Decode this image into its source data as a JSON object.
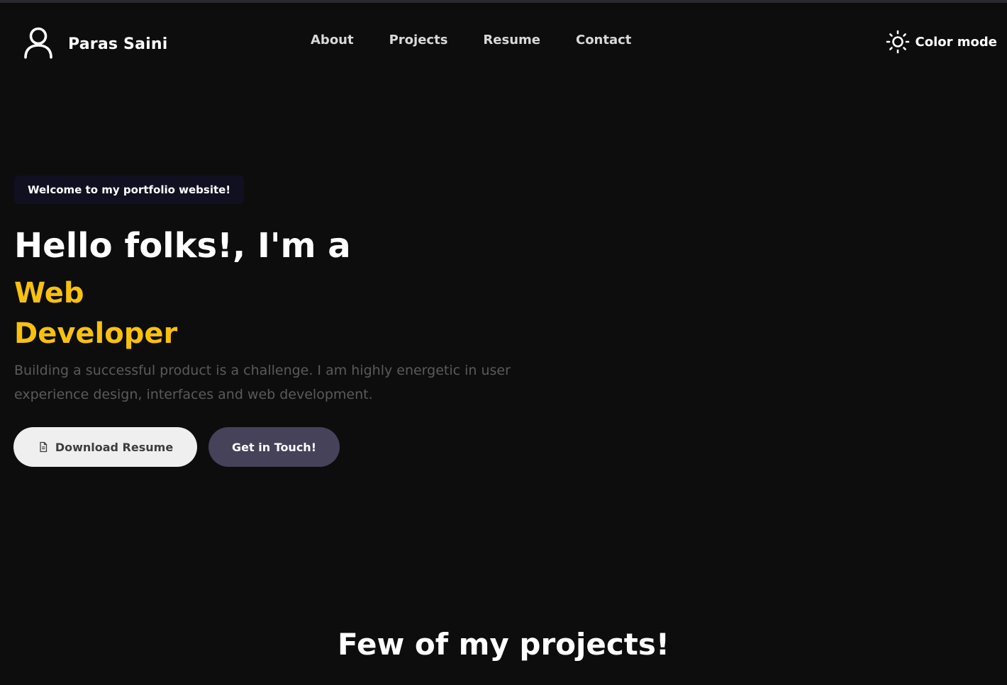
{
  "brand": {
    "icon": "user-icon",
    "name": "Paras Saini"
  },
  "nav": {
    "items": [
      {
        "label": "About"
      },
      {
        "label": "Projects"
      },
      {
        "label": "Resume"
      },
      {
        "label": "Contact"
      }
    ]
  },
  "color_mode": {
    "icon": "sun-icon",
    "label": "Color mode"
  },
  "hero": {
    "badge": "Welcome to my portfolio website!",
    "title": "Hello folks!, I'm a",
    "role_line1": "Web",
    "role_line2": "Developer",
    "description": "Building a successful product is a challenge. I am highly energetic in user experience design, interfaces and web development.",
    "download_button": {
      "label": "Download Resume",
      "icon": "document-icon"
    },
    "contact_button": {
      "label": "Get in Touch!"
    }
  },
  "projects_section": {
    "title": "Few of my projects!"
  },
  "colors": {
    "background": "#0d0d0d",
    "accent": "#f7c10f",
    "secondary_button": "#45425a"
  }
}
